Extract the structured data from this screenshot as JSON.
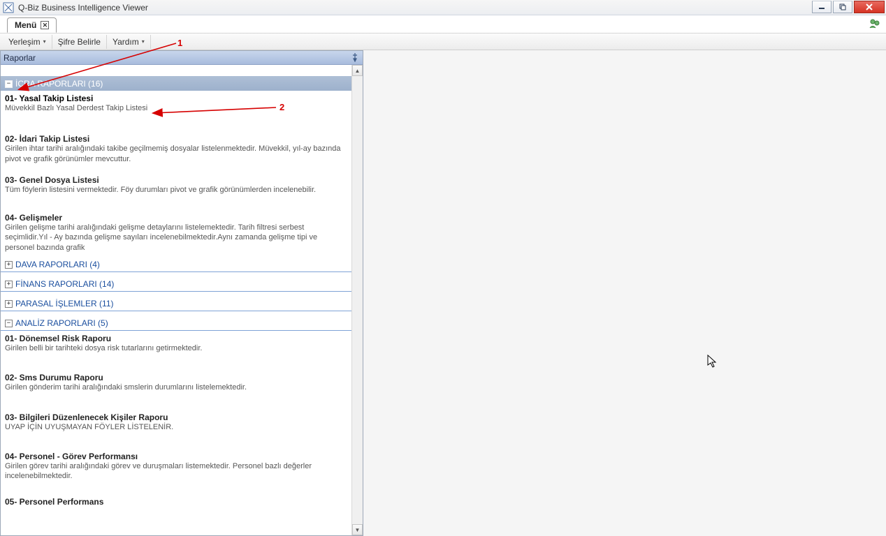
{
  "window": {
    "title": "Q-Biz Business Intelligence Viewer"
  },
  "tabs": {
    "main": {
      "label": "Menü"
    }
  },
  "menubar": {
    "layout": "Yerleşim",
    "password": "Şifre Belirle",
    "help": "Yardım"
  },
  "panel": {
    "title": "Raporlar"
  },
  "groups": [
    {
      "key": "icra",
      "label": "İCRA RAPORLARI (16)",
      "expanded": true,
      "active": true
    },
    {
      "key": "dava",
      "label": "DAVA RAPORLARI (4)",
      "expanded": false,
      "active": false
    },
    {
      "key": "finans",
      "label": "FİNANS RAPORLARI (14)",
      "expanded": false,
      "active": false
    },
    {
      "key": "parasal",
      "label": "PARASAL İŞLEMLER (11)",
      "expanded": false,
      "active": false
    },
    {
      "key": "analiz",
      "label": "ANALİZ RAPORLARI (5)",
      "expanded": true,
      "active": false
    }
  ],
  "icra_items": [
    {
      "title": "01- Yasal Takip Listesi",
      "desc": "Müvekkil Bazlı Yasal Derdest Takip Listesi"
    },
    {
      "title": "02- İdari Takip Listesi",
      "desc": "Girilen ihtar tarihi aralığındaki takibe geçilmemiş dosyalar listelenmektedir. Müvekkil, yıl-ay bazında pivot ve grafik görünümler mevcuttur."
    },
    {
      "title": "03- Genel Dosya Listesi",
      "desc": "Tüm föylerin listesini vermektedir. Föy durumları pivot ve grafik görünümlerden incelenebilir."
    },
    {
      "title": "04- Gelişmeler",
      "desc": "Girilen gelişme tarihi aralığındaki gelişme detaylarını listelemektedir. Tarih filtresi serbest seçimlidir.Yıl - Ay bazında gelişme sayıları incelenebilmektedir.Aynı zamanda gelişme tipi ve personel bazında grafik"
    }
  ],
  "analiz_items": [
    {
      "title": "01- Dönemsel Risk Raporu",
      "desc": "Girilen belli bir tarihteki dosya risk tutarlarını getirmektedir."
    },
    {
      "title": "02- Sms Durumu Raporu",
      "desc": "Girilen gönderim tarihi aralığındaki smslerin durumlarını listelemektedir."
    },
    {
      "title": "03- Bilgileri Düzenlenecek Kişiler Raporu",
      "desc": "UYAP İÇİN UYUŞMAYAN FÖYLER LİSTELENİR."
    },
    {
      "title": "04- Personel - Görev Performansı",
      "desc": "Girilen görev tarihi aralığındaki görev ve duruşmaları listemektedir. Personel bazlı değerler incelenebilmektedir."
    },
    {
      "title": "05- Personel Performans",
      "desc": ""
    }
  ],
  "annotations": {
    "one": "1",
    "two": "2"
  },
  "glyph": {
    "minus": "−",
    "plus": "+"
  }
}
